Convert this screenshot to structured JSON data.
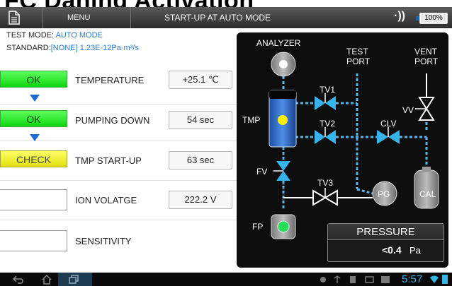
{
  "heading": "FC Daning Activation",
  "topbar": {
    "menu_label": "MENU",
    "title": "START-UP AT AUTO MODE",
    "battery": "100%",
    "wifi_glyph": "·))"
  },
  "info": {
    "mode_label": "TEST MODE:",
    "mode_value": "AUTO MODE",
    "standard_label": "STANDARD:",
    "standard_value": "[NONE] 1.23E-12Pa·m³/s"
  },
  "rows": [
    {
      "status": "OK",
      "label": "TEMPERATURE",
      "value": "+25.1 ℃"
    },
    {
      "status": "OK",
      "label": "PUMPING DOWN",
      "value": "54 sec"
    },
    {
      "status": "CHECK",
      "label": "TMP START-UP",
      "value": "63 sec"
    },
    {
      "status": "",
      "label": "ION VOLATGE",
      "value": "222.2 V"
    },
    {
      "status": "",
      "label": "SENSITIVITY",
      "value": ""
    }
  ],
  "diagram": {
    "analyzer": "ANALYZER",
    "test_port": "TEST\nPORT",
    "test_port_l1": "TEST",
    "test_port_l2": "PORT",
    "vent_port_l1": "VENT",
    "vent_port_l2": "PORT",
    "tv1": "TV1",
    "tv2": "TV2",
    "tv3": "TV3",
    "clv": "CLV",
    "vv": "VV",
    "tmp": "TMP",
    "fv": "FV",
    "fp": "FP",
    "pg": "PG",
    "cal": "CAL",
    "pressure_title": "PRESSURE",
    "pressure_value": "<0.4",
    "pressure_unit": "Pa"
  },
  "navbar": {
    "clock": "5:57",
    "back_icon": "back-icon",
    "home_icon": "home-icon",
    "recent_icon": "recent-apps-icon"
  },
  "colors": {
    "ok": "#22dd22",
    "check": "#eeee22",
    "line": "#5ab6e8",
    "valve": "#35b3ea",
    "accent_blue": "#2a7ad2"
  }
}
